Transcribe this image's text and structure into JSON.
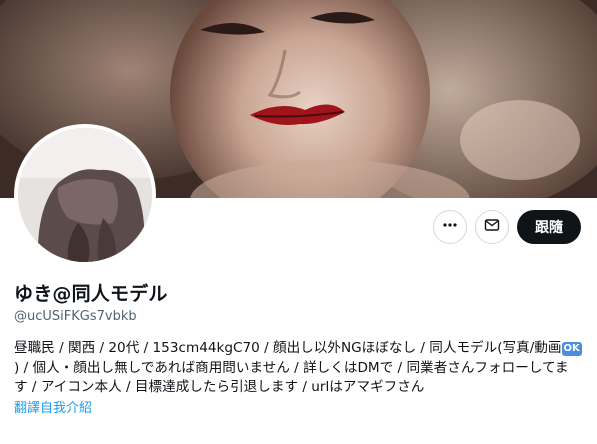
{
  "profile": {
    "display_name": "ゆき@同人モデル",
    "handle": "@ucUSiFKGs7vbkb",
    "bio_part1": "昼職民 / 関西 / 20代 / 153cm44kgC70 / 顔出し以外NGほぼなし / 同人モデル(写真/動画",
    "bio_ok": "OK",
    "bio_part2": ") / 個人・顔出し無しであれば商用問いません / 詳しくはDMで / 同業者さんフォローしてます / アイコン本人 / 目標達成したら引退します / urlはアマギフさん",
    "translate_link": "翻譯自我介紹"
  },
  "actions": {
    "more_icon": "more-dots-icon",
    "message_icon": "envelope-icon",
    "follow_label": "跟隨"
  },
  "colors": {
    "follow_bg": "#0f1419",
    "link": "#1d9bf0",
    "handle": "#536471"
  }
}
